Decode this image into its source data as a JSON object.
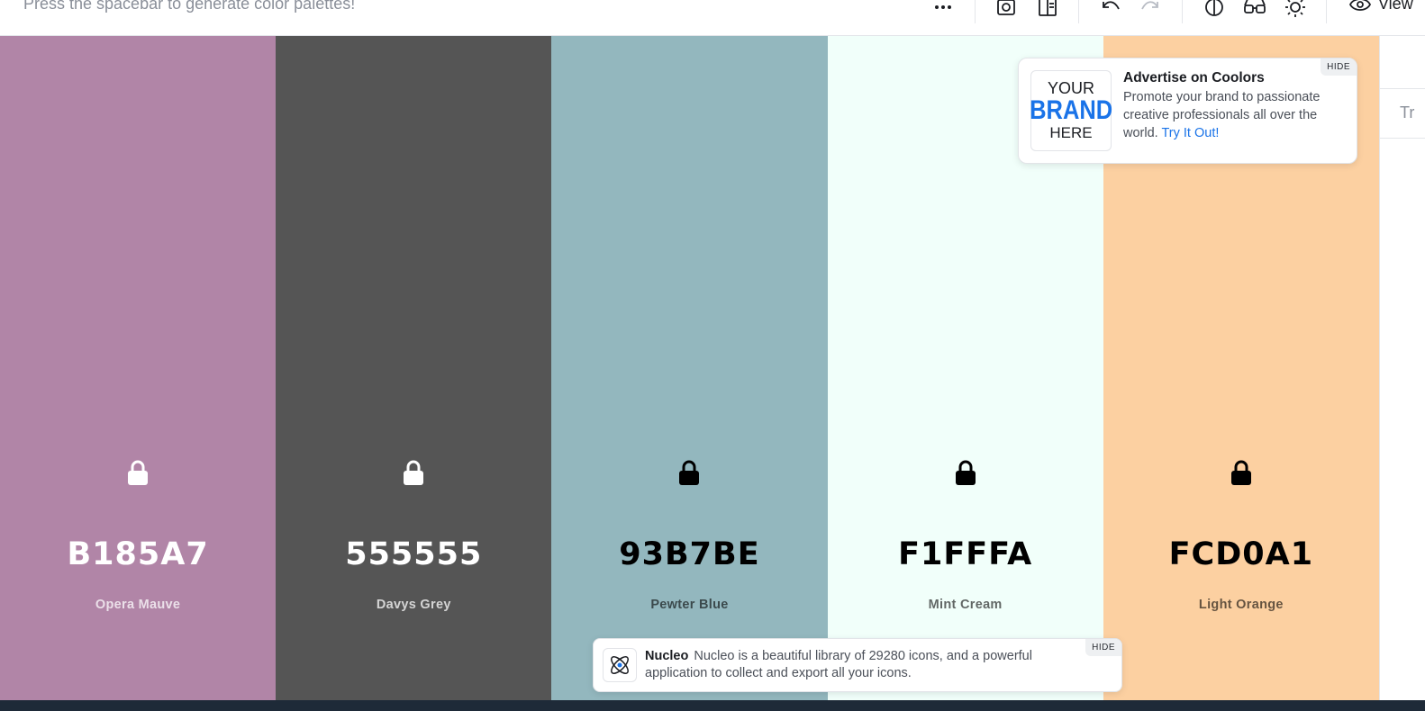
{
  "toolbar": {
    "hint": "Press the spacebar to generate color palettes!",
    "view_label": "View"
  },
  "icons": [
    "more-icon",
    "camera-icon",
    "book-icon",
    "undo-icon",
    "redo-icon",
    "contrast-icon",
    "glasses-icon",
    "sun-icon",
    "eye-icon",
    "lock-icon"
  ],
  "palette": [
    {
      "hex": "B185A7",
      "name": "Opera Mauve",
      "color": "#B185A7",
      "text_color": "#ffffff",
      "name_color": "rgba(255,255,255,0.75)",
      "lock_color": "#ffffff"
    },
    {
      "hex": "555555",
      "name": "Davys Grey",
      "color": "#555555",
      "text_color": "#ffffff",
      "name_color": "rgba(255,255,255,0.75)",
      "lock_color": "#ffffff"
    },
    {
      "hex": "93B7BE",
      "name": "Pewter Blue",
      "color": "#93B7BE",
      "text_color": "#000000",
      "name_color": "rgba(0,0,0,0.6)",
      "lock_color": "#000000"
    },
    {
      "hex": "F1FFFA",
      "name": "Mint Cream",
      "color": "#F1FFFA",
      "text_color": "#000000",
      "name_color": "rgba(0,0,0,0.6)",
      "lock_color": "#000000"
    },
    {
      "hex": "FCD0A1",
      "name": "Light Orange",
      "color": "#FCD0A1",
      "text_color": "#000000",
      "name_color": "rgba(0,0,0,0.6)",
      "lock_color": "#000000"
    }
  ],
  "right_panel": {
    "partial_text": "Tr"
  },
  "ad_coolors": {
    "hide_label": "HIDE",
    "brand_line1": "YOUR",
    "brand_line2": "BRAND",
    "brand_line3": "HERE",
    "title": "Advertise on Coolors",
    "body": "Promote your brand to passionate creative professionals all over the world.",
    "link": "Try It Out!"
  },
  "ad_nucleo": {
    "hide_label": "HIDE",
    "title": "Nucleo",
    "body": "Nucleo is a beautiful library of 29280 icons, and a powerful application to collect and export all your icons."
  },
  "colors": {
    "accent": "#1a73e8",
    "border": "#e4e6ea",
    "bottom_strip": "#1e2a38"
  }
}
